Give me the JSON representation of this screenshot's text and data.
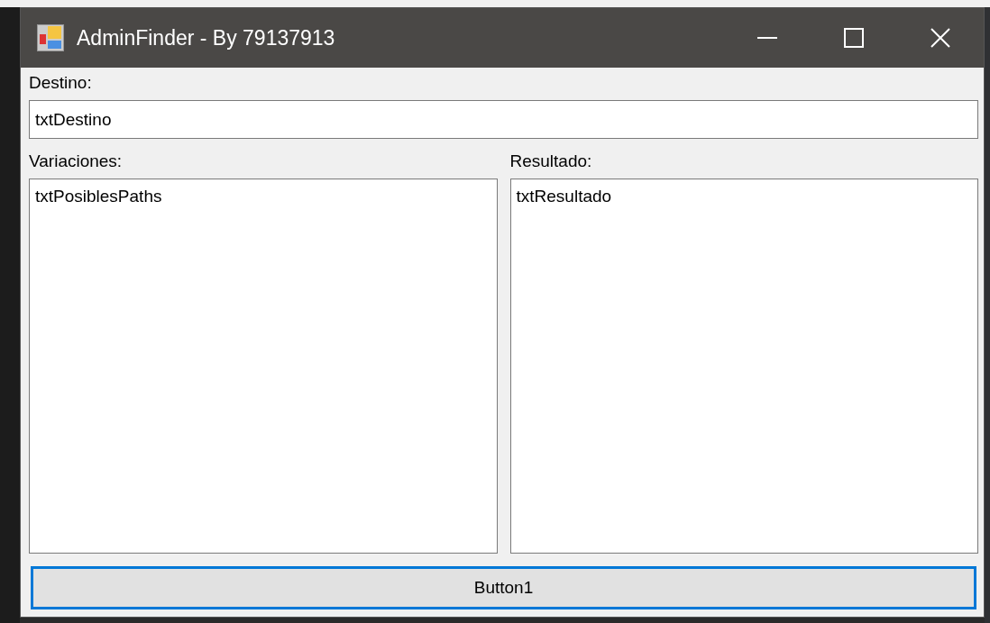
{
  "window": {
    "title": "AdminFinder - By 79137913"
  },
  "destino": {
    "label": "Destino:",
    "value": "txtDestino"
  },
  "panels": [
    {
      "label": "Variaciones:",
      "value": "txtPosiblesPaths"
    },
    {
      "label": "Resultado:",
      "value": "txtResultado"
    }
  ],
  "button": {
    "label": "Button1",
    "focused": true
  }
}
